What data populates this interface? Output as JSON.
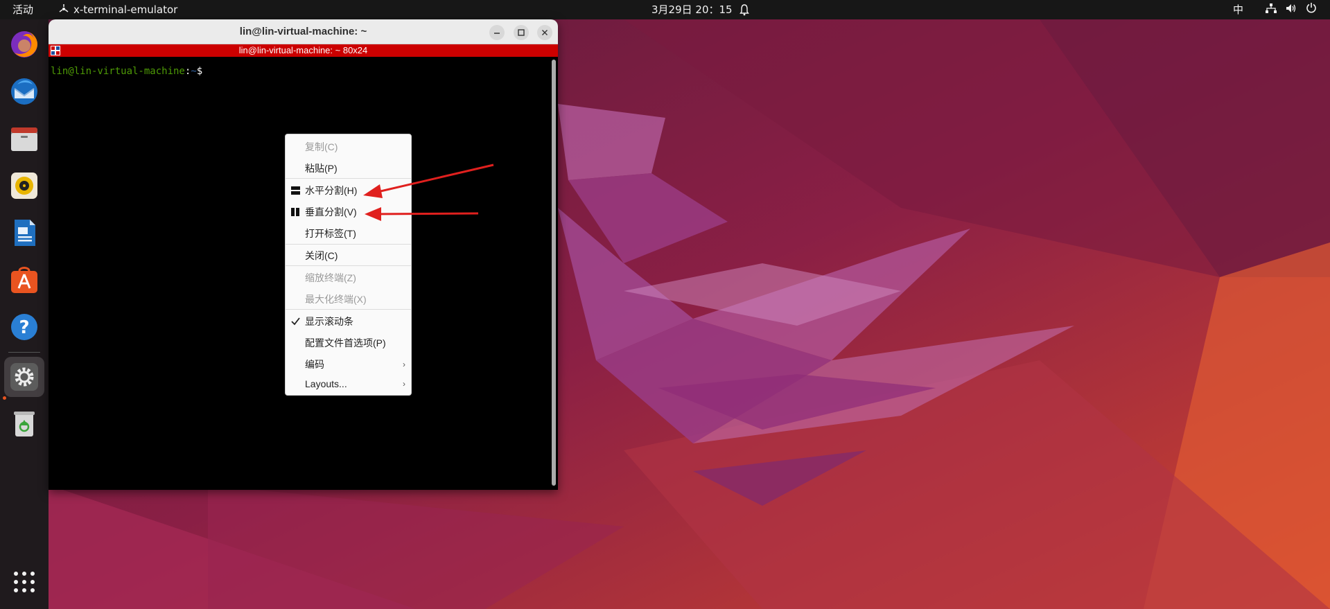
{
  "topbar": {
    "activities": "活动",
    "app_name": "x-terminal-emulator",
    "clock": "3月29日  20：15",
    "input_method": "中",
    "tray_icons": [
      "network-icon",
      "volume-icon",
      "power-icon"
    ]
  },
  "dock": {
    "items": [
      "firefox-icon",
      "thunderbird-icon",
      "files-icon",
      "rhythmbox-icon",
      "libreoffice-writer-icon",
      "app-center-icon",
      "help-icon",
      "settings-icon",
      "trash-icon"
    ],
    "show_apps": "app-grid-icon"
  },
  "terminal": {
    "window_title": "lin@lin-virtual-machine: ~",
    "info_bar": "lin@lin-virtual-machine: ~ 80x24",
    "prompt_user": "lin@lin-virtual-machine",
    "prompt_sep": ":",
    "prompt_path": "~",
    "prompt_symbol": "$"
  },
  "context_menu": {
    "copy": "复制(C)",
    "paste": "粘贴(P)",
    "split_horizontal": "水平分割(H)",
    "split_vertical": "垂直分割(V)",
    "open_tab": "打开标签(T)",
    "close": "关闭(C)",
    "zoom_terminal": "缩放终端(Z)",
    "maximize_terminal": "最大化终端(X)",
    "show_scrollbar": "显示滚动条",
    "profile_preferences": "配置文件首选项(P)",
    "encoding": "编码",
    "layouts": "Layouts..."
  },
  "colors": {
    "accent": "#e95420",
    "annotation_arrow": "#e0201e",
    "terminal_banner": "#cc0000"
  }
}
